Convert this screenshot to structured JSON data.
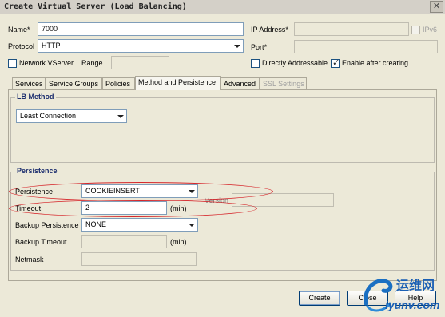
{
  "window": {
    "title": "Create Virtual Server (Load Balancing)"
  },
  "form": {
    "name_label": "Name*",
    "name_value": "7000",
    "protocol_label": "Protocol",
    "protocol_value": "HTTP",
    "network_vserver_label": "Network VServer",
    "range_label": "Range",
    "ip_label": "IP Address*",
    "ipv6_label": "IPv6",
    "port_label": "Port*",
    "directly_addressable_label": "Directly Addressable",
    "enable_after_creating_label": "Enable after creating"
  },
  "tabs": [
    {
      "label": "Services"
    },
    {
      "label": "Service Groups"
    },
    {
      "label": "Policies"
    },
    {
      "label": "Method and Persistence"
    },
    {
      "label": "Advanced"
    },
    {
      "label": "SSL Settings"
    }
  ],
  "lb_method": {
    "group_title": "LB Method",
    "value": "Least Connection"
  },
  "persistence": {
    "group_title": "Persistence",
    "persistence_label": "Persistence",
    "persistence_value": "COOKIEINSERT",
    "timeout_label": "Timeout",
    "timeout_value": "2",
    "timeout_unit": "(min)",
    "version_label": "Version",
    "backup_persistence_label": "Backup Persistence",
    "backup_persistence_value": "NONE",
    "backup_timeout_label": "Backup Timeout",
    "backup_timeout_unit": "(min)",
    "netmask_label": "Netmask"
  },
  "buttons": {
    "create": "Create",
    "close": "Close",
    "help": "Help"
  },
  "watermark": {
    "cn": "运维网",
    "url": "iyunv.com"
  },
  "colors": {
    "highlight_ellipse": "#d6262b",
    "group_title": "#1d2f6f"
  }
}
